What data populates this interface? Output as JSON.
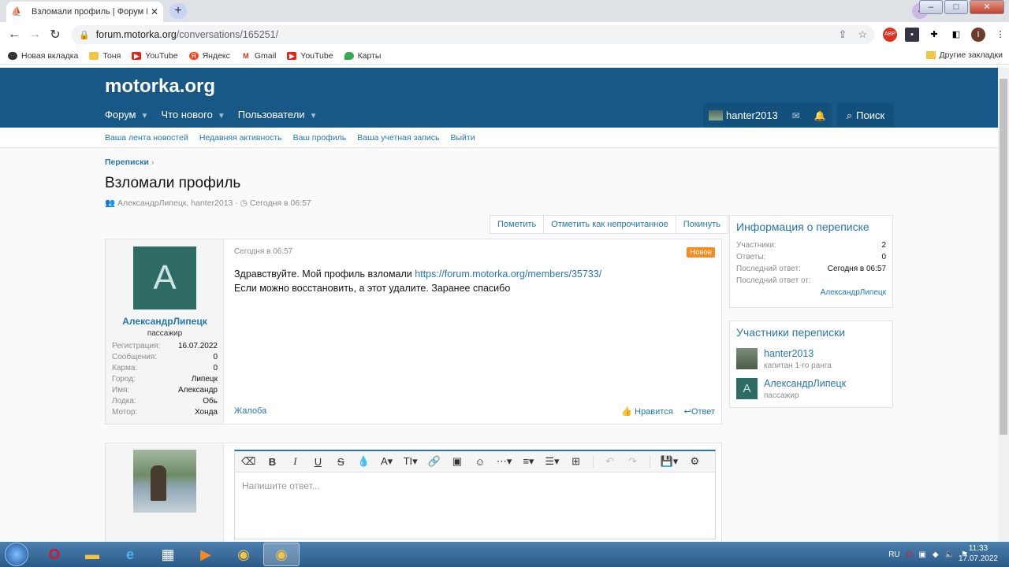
{
  "browser": {
    "tab_title": "Взломали профиль | Форум Мо",
    "url_host": "forum.motorka.org",
    "url_path": "/conversations/165251/",
    "profile_initial": "I",
    "bookmarks": [
      {
        "label": "Новая вкладка",
        "color": "#333"
      },
      {
        "label": "Тоня",
        "color": "#f4c542"
      },
      {
        "label": "YouTube",
        "color": "#e62117"
      },
      {
        "label": "Яндекс",
        "color": "#fc3f1d"
      },
      {
        "label": "Gmail",
        "color": "#d93025"
      },
      {
        "label": "YouTube",
        "color": "#e62117"
      },
      {
        "label": "Карты",
        "color": "#34a853"
      }
    ],
    "other_bookmarks": "Другие закладки"
  },
  "site": {
    "logo": "motorka.org",
    "nav": [
      "Форум",
      "Что нового",
      "Пользователи"
    ],
    "username": "hanter2013",
    "search": "Поиск",
    "subnav": [
      "Ваша лента новостей",
      "Недавняя активность",
      "Ваш профиль",
      "Ваша учетная запись",
      "Выйти"
    ]
  },
  "page": {
    "breadcrumb": "Переписки",
    "title": "Взломали профиль",
    "meta_participants": "АлександрЛипецк, hanter2013",
    "meta_time": "Сегодня в 06:57",
    "actions": [
      "Пометить",
      "Отметить как непрочитанное",
      "Покинуть"
    ]
  },
  "message": {
    "avatar_letter": "A",
    "author": "АлександрЛипецк",
    "user_title": "пассажир",
    "stats": [
      {
        "k": "Регистрация:",
        "v": "16.07.2022"
      },
      {
        "k": "Сообщения:",
        "v": "0"
      },
      {
        "k": "Карма:",
        "v": "0"
      },
      {
        "k": "Город:",
        "v": "Липецк"
      },
      {
        "k": "Имя:",
        "v": "Александр"
      },
      {
        "k": "Лодка:",
        "v": "Обь"
      },
      {
        "k": "Мотор:",
        "v": "Хонда"
      }
    ],
    "date": "Сегодня в 06:57",
    "badge": "Новое",
    "text_line1": "Здравствуйте. Мой профиль взломали ",
    "link": "https://forum.motorka.org/members/35733/",
    "text_line2": "Если можно восстановить, а этот удалите. Заранее спасибо",
    "report": "Жалоба",
    "like": "Нравится",
    "reply": "Ответ"
  },
  "info": {
    "title": "Информация о переписке",
    "rows": [
      {
        "k": "Участники:",
        "v": "2"
      },
      {
        "k": "Ответы:",
        "v": "0"
      },
      {
        "k": "Последний ответ:",
        "v": "Сегодня в 06:57"
      },
      {
        "k": "Последний ответ от:",
        "v": ""
      }
    ],
    "last_by": "АлександрЛипецк"
  },
  "participants": {
    "title": "Участники переписки",
    "list": [
      {
        "name": "hanter2013",
        "role": "капитан 1-го ранга"
      },
      {
        "name": "АлександрЛипецк",
        "role": "пассажир",
        "letter": "A"
      }
    ]
  },
  "editor": {
    "placeholder": "Напишите ответ..."
  },
  "taskbar": {
    "lang": "RU",
    "time": "11:33",
    "date": "17.07.2022"
  }
}
